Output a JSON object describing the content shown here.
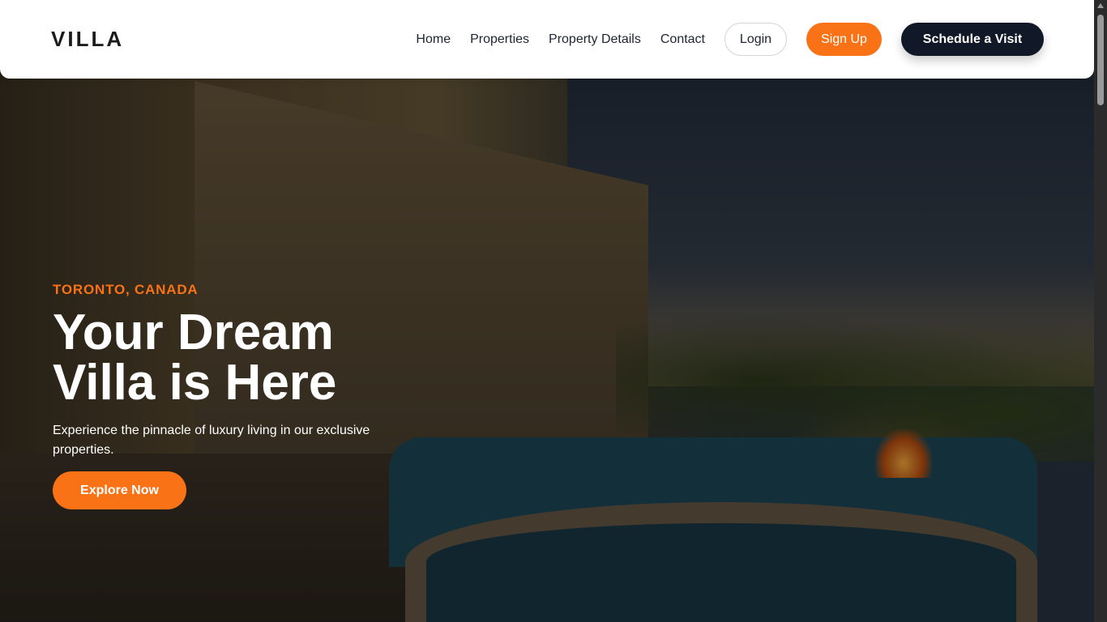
{
  "header": {
    "logo": "VILLA",
    "nav": [
      "Home",
      "Properties",
      "Property Details",
      "Contact"
    ],
    "login": "Login",
    "signup": "Sign Up",
    "schedule": "Schedule a Visit"
  },
  "hero": {
    "location": "TORONTO, CANADA",
    "title_line1": "Your Dream",
    "title_line2": "Villa is Here",
    "description": "Experience the pinnacle of luxury living in our exclusive properties.",
    "cta": "Explore Now"
  },
  "colors": {
    "accent": "#f97316",
    "dark": "#111827"
  }
}
